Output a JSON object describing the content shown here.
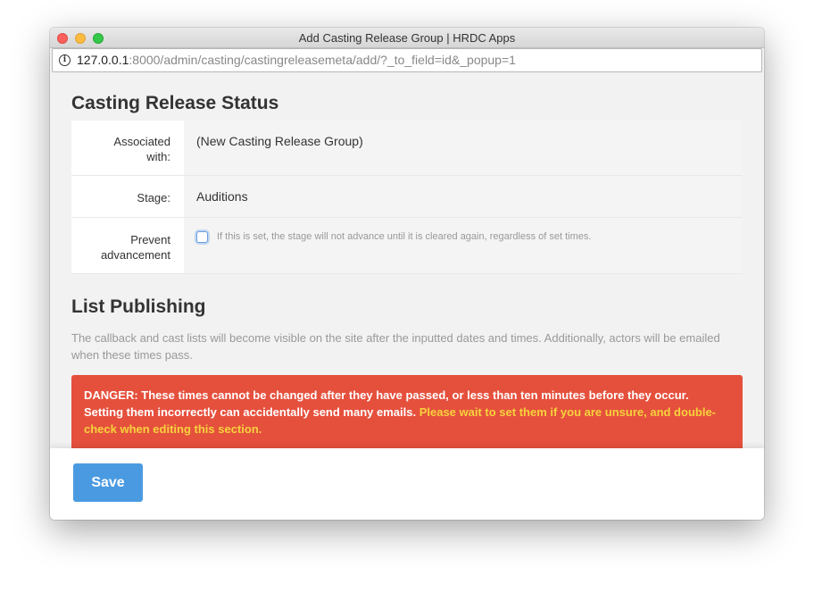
{
  "window": {
    "title": "Add Casting Release Group | HRDC Apps"
  },
  "address_bar": {
    "host": "127.0.0.1",
    "rest": ":8000/admin/casting/castingreleasemeta/add/?_to_field=id&_popup=1"
  },
  "status_section": {
    "heading": "Casting Release Status",
    "rows": [
      {
        "label": "Associated with:",
        "value": "(New Casting Release Group)"
      },
      {
        "label": "Stage:",
        "value": "Auditions"
      },
      {
        "label": "Prevent advancement",
        "checked": false,
        "help": "If this is set, the stage will not advance until it is cleared again, regardless of set times."
      }
    ]
  },
  "publishing_section": {
    "heading": "List Publishing",
    "description": "The callback and cast lists will become visible on the site after the inputted dates and times. Additionally, actors will be emailed when these times pass.",
    "danger_main": "DANGER: These times cannot be changed after they have passed, or less than ten minutes before they occur. Setting them incorrectly can accidentally send many emails. ",
    "danger_warn": "Please wait to set them if you are unsure, and double-check when editing this section."
  },
  "footer": {
    "save_label": "Save"
  },
  "colors": {
    "danger_bg": "#e5503d",
    "danger_warn_text": "#f7d23c",
    "save_button": "#4a9ae1"
  }
}
